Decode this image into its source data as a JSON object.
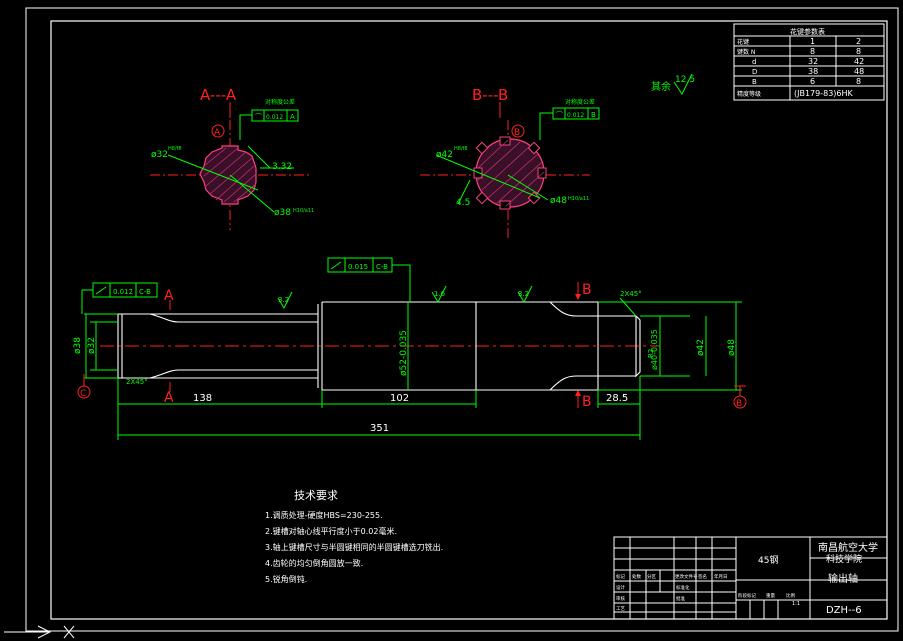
{
  "sections": {
    "a_label": "A---A",
    "b_label": "B---B"
  },
  "section_a": {
    "circle_tag": "A",
    "dims": {
      "d_top": "ø32",
      "d_small": "3.32",
      "d_bottom": "ø38"
    },
    "tol_box": {
      "sym": "⌒",
      "val": "0.012",
      "ref": "A"
    },
    "tol_label": "对称度公差"
  },
  "section_b": {
    "circle_tag": "B",
    "dims": {
      "d_top": "ø42",
      "d_small": "4.5",
      "d_bottom": "ø48"
    },
    "tol_box": {
      "sym": "⌒",
      "val": "0.012",
      "ref": "B"
    },
    "tol_label": "对称度公差"
  },
  "spline_table": {
    "title": "花键参数表",
    "rows": [
      [
        "花键",
        "1",
        "2"
      ],
      [
        "键数 N",
        "8",
        "8"
      ],
      [
        "d",
        "32",
        "42"
      ],
      [
        "D",
        "38",
        "48"
      ],
      [
        "B",
        "6",
        "8"
      ],
      [
        "精度等级",
        "(JB179-83)6HK",
        ""
      ]
    ]
  },
  "roughness_note": {
    "label": "其余",
    "value": "12.5"
  },
  "shaft": {
    "tol_left": {
      "val": "0.012",
      "ref": "C-B"
    },
    "tol_mid": {
      "val": "0.015",
      "ref": "C-B"
    },
    "cut_a": "A",
    "cut_b": "B",
    "datum_c": "C",
    "datum_b": "B",
    "rough_left": "3.2",
    "rough_mid": "1.6",
    "rough_right": "3.2",
    "chamfer_right": "2X45°",
    "chamfer_left": "2X45°",
    "dims": {
      "d38": "ø38",
      "d32": "ø32",
      "d52": "ø52-0.035",
      "d40": "ø40-0.035",
      "d42": "ø42",
      "d48": "ø48",
      "d_r": "R2",
      "len_138": "138",
      "len_102": "102",
      "len_285": "28.5",
      "len_351": "351"
    }
  },
  "tech_req": {
    "title": "技术要求",
    "items": [
      "1.调质处理-硬度HBS=230-255.",
      "2.键槽对轴心线平行度小于0.02毫米.",
      "3.轴上键槽尺寸与半圆键相同的半圆键槽选刀铣出.",
      "4.齿轮的均匀倒角圆放一致.",
      "5.锐角倒钝."
    ]
  },
  "title_block": {
    "material": "45钢",
    "school_1": "南昌航空大学",
    "school_2": "科技学院",
    "part_name": "输出轴",
    "drawing_no": "DZH--6",
    "scale": "1:1",
    "small_labels": [
      "标记",
      "处数",
      "分区",
      "更改文件号",
      "签名",
      "年月日",
      "设计",
      "标准化",
      "审核",
      "工艺",
      "批准",
      "阶段标记",
      "重量",
      "比例"
    ]
  }
}
